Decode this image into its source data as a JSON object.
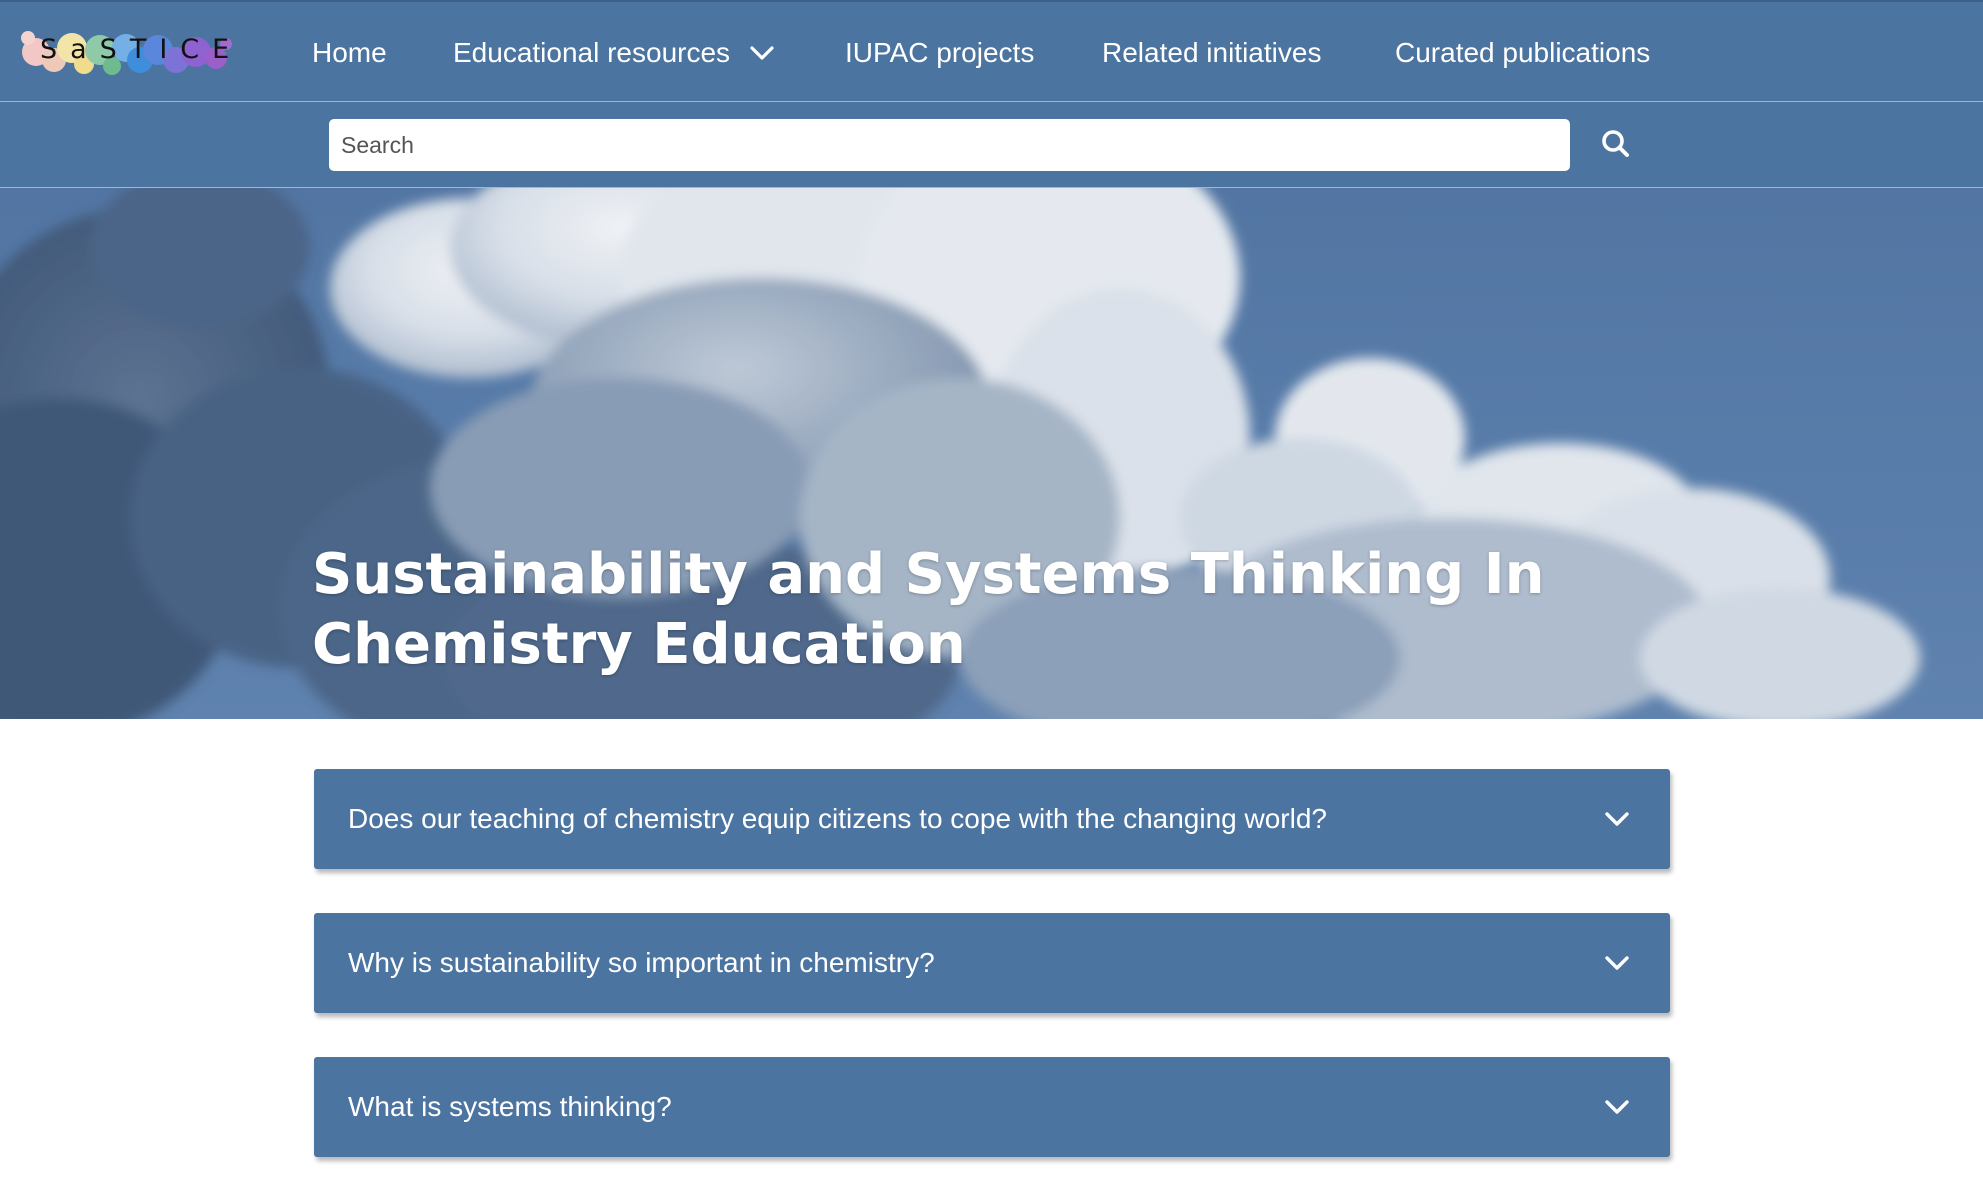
{
  "brand": {
    "logo_text": "SaSTICE"
  },
  "nav": {
    "items": [
      {
        "label": "Home",
        "has_dropdown": false
      },
      {
        "label": "Educational resources",
        "has_dropdown": true
      },
      {
        "label": "IUPAC projects",
        "has_dropdown": false
      },
      {
        "label": "Related initiatives",
        "has_dropdown": false
      },
      {
        "label": "Curated publications",
        "has_dropdown": false
      }
    ]
  },
  "search": {
    "placeholder": "Search",
    "value": "",
    "button_icon": "search-icon"
  },
  "hero": {
    "title_line1": "Sustainability and Systems Thinking In",
    "title_line2": "Chemistry Education"
  },
  "accordion": {
    "items": [
      {
        "question": "Does our teaching of chemistry equip citizens to cope with the changing world?",
        "icon": "chevron-down-icon"
      },
      {
        "question": "Why is sustainability so important in chemistry?",
        "icon": "chevron-down-icon"
      },
      {
        "question": "What is systems thinking?",
        "icon": "chevron-down-icon"
      }
    ]
  },
  "colors": {
    "primary": "#4b74a0",
    "text_on_primary": "#ffffff",
    "background": "#ffffff"
  }
}
